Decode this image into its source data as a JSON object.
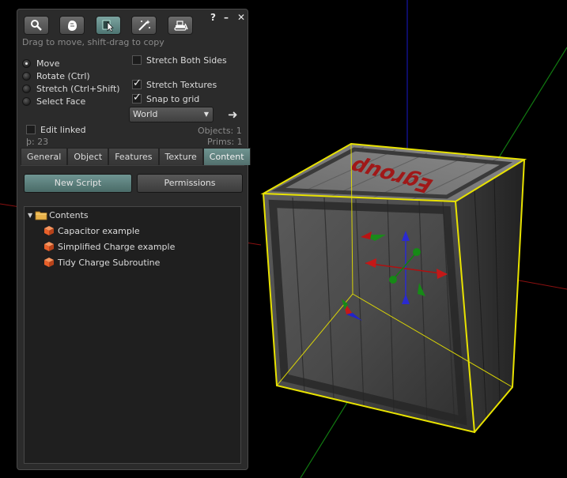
{
  "hint": "Drag to move, shift-drag to copy",
  "window_controls": {
    "help": "?",
    "minimize": "–",
    "close": "✕"
  },
  "tools": [
    {
      "name": "Focus",
      "icon": "magnifier-icon"
    },
    {
      "name": "Move",
      "icon": "grab-hand-icon"
    },
    {
      "name": "Edit",
      "icon": "pointer-arrow-icon"
    },
    {
      "name": "Create",
      "icon": "magic-wand-icon"
    },
    {
      "name": "Land",
      "icon": "bulldozer-icon"
    }
  ],
  "modes": {
    "move": "Move",
    "rotate": "Rotate (Ctrl)",
    "stretch": "Stretch (Ctrl+Shift)",
    "select_face": "Select Face"
  },
  "options": {
    "stretch_both_sides": "Stretch Both Sides",
    "stretch_textures": "Stretch Textures",
    "snap_to_grid": "Snap to grid",
    "edit_linked": "Edit linked"
  },
  "grid": {
    "selected": "World"
  },
  "stats": {
    "objects": "Objects: 1",
    "prims": "Prims: 1",
    "land_impact": "þ: 23"
  },
  "tabs": [
    "General",
    "Object",
    "Features",
    "Texture",
    "Content"
  ],
  "active_tab": "Content",
  "content": {
    "new_script": "New Script",
    "permissions": "Permissions",
    "folder": "Contents",
    "items": [
      "Capacitor example",
      "Simplified Charge example",
      "Tidy Charge Subroutine"
    ]
  },
  "colors": {
    "accent": "#5f8683",
    "selection": "#e8e200",
    "object_icon": "#e8602a"
  }
}
